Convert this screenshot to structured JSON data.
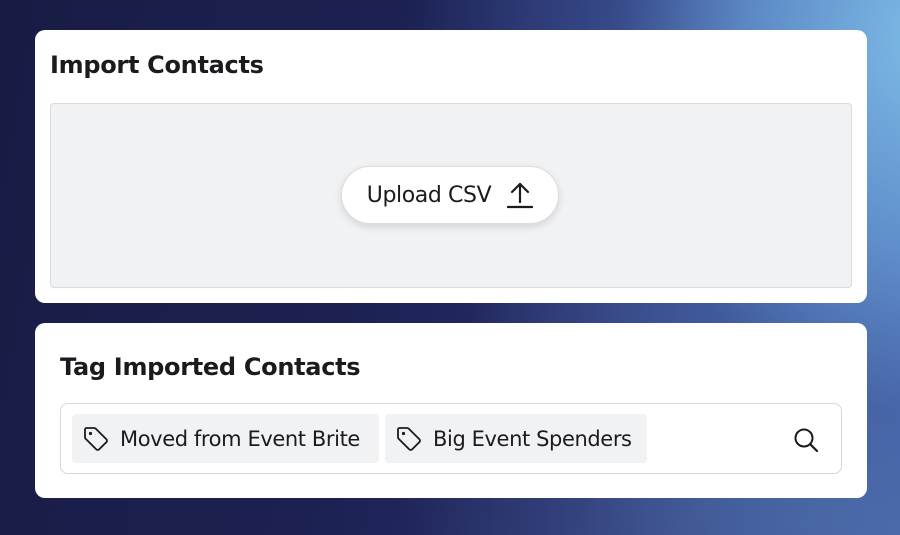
{
  "import_card": {
    "title": "Import Contacts",
    "upload_button": {
      "label": "Upload CSV",
      "icon": "upload-arrow-icon"
    }
  },
  "tag_card": {
    "title": "Tag Imported Contacts",
    "tags": [
      {
        "label": "Moved from Event Brite",
        "icon": "tag-icon"
      },
      {
        "label": "Big Event Spenders",
        "icon": "tag-icon"
      }
    ],
    "search_icon": "search-icon"
  },
  "colors": {
    "card_background": "#ffffff",
    "dropzone_background": "#f1f2f3",
    "chip_background": "#f1f2f3",
    "text": "#1b1b1f"
  }
}
